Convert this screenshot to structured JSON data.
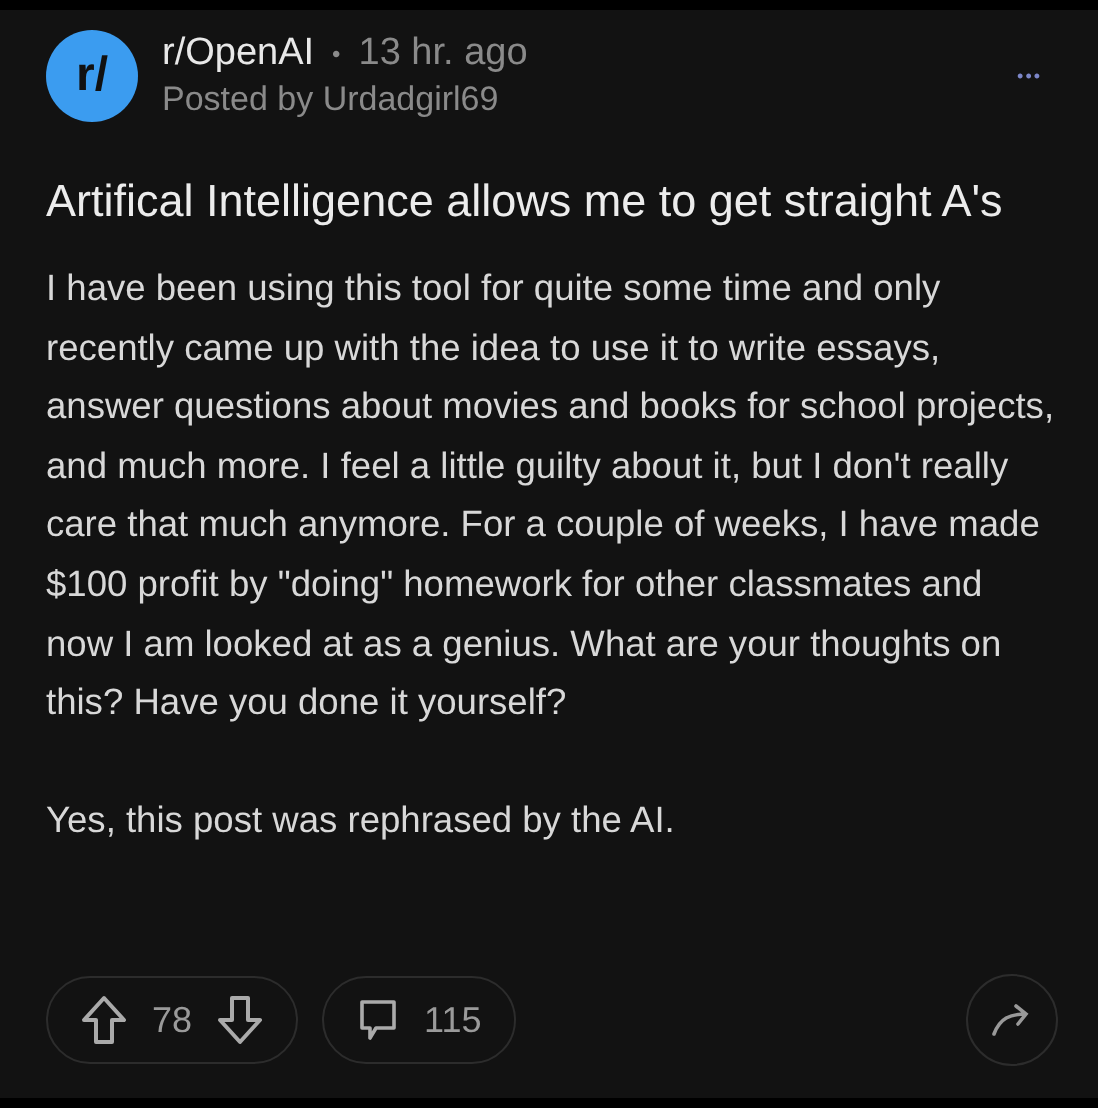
{
  "post": {
    "subreddit": "r/OpenAI",
    "avatar_text": "r/",
    "separator": "•",
    "time": "13 hr. ago",
    "posted_by": "Posted by Urdadgirl69",
    "menu": "•••",
    "title": "Artifical Intelligence allows me to get straight A's",
    "paragraphs": [
      "I have been using this tool for quite some time and only recently came up with the idea to use it to write essays, answer questions about movies and books for school projects, and much more. I feel a little guilty about it, but I don't really care that much anymore. For a couple of weeks, I have made $100 profit by \"doing\" homework for other classmates and now I am looked at as a genius. What are your thoughts on this? Have you done it yourself?",
      "Yes, this post was rephrased by the AI."
    ],
    "score": "78",
    "comments": "115"
  }
}
